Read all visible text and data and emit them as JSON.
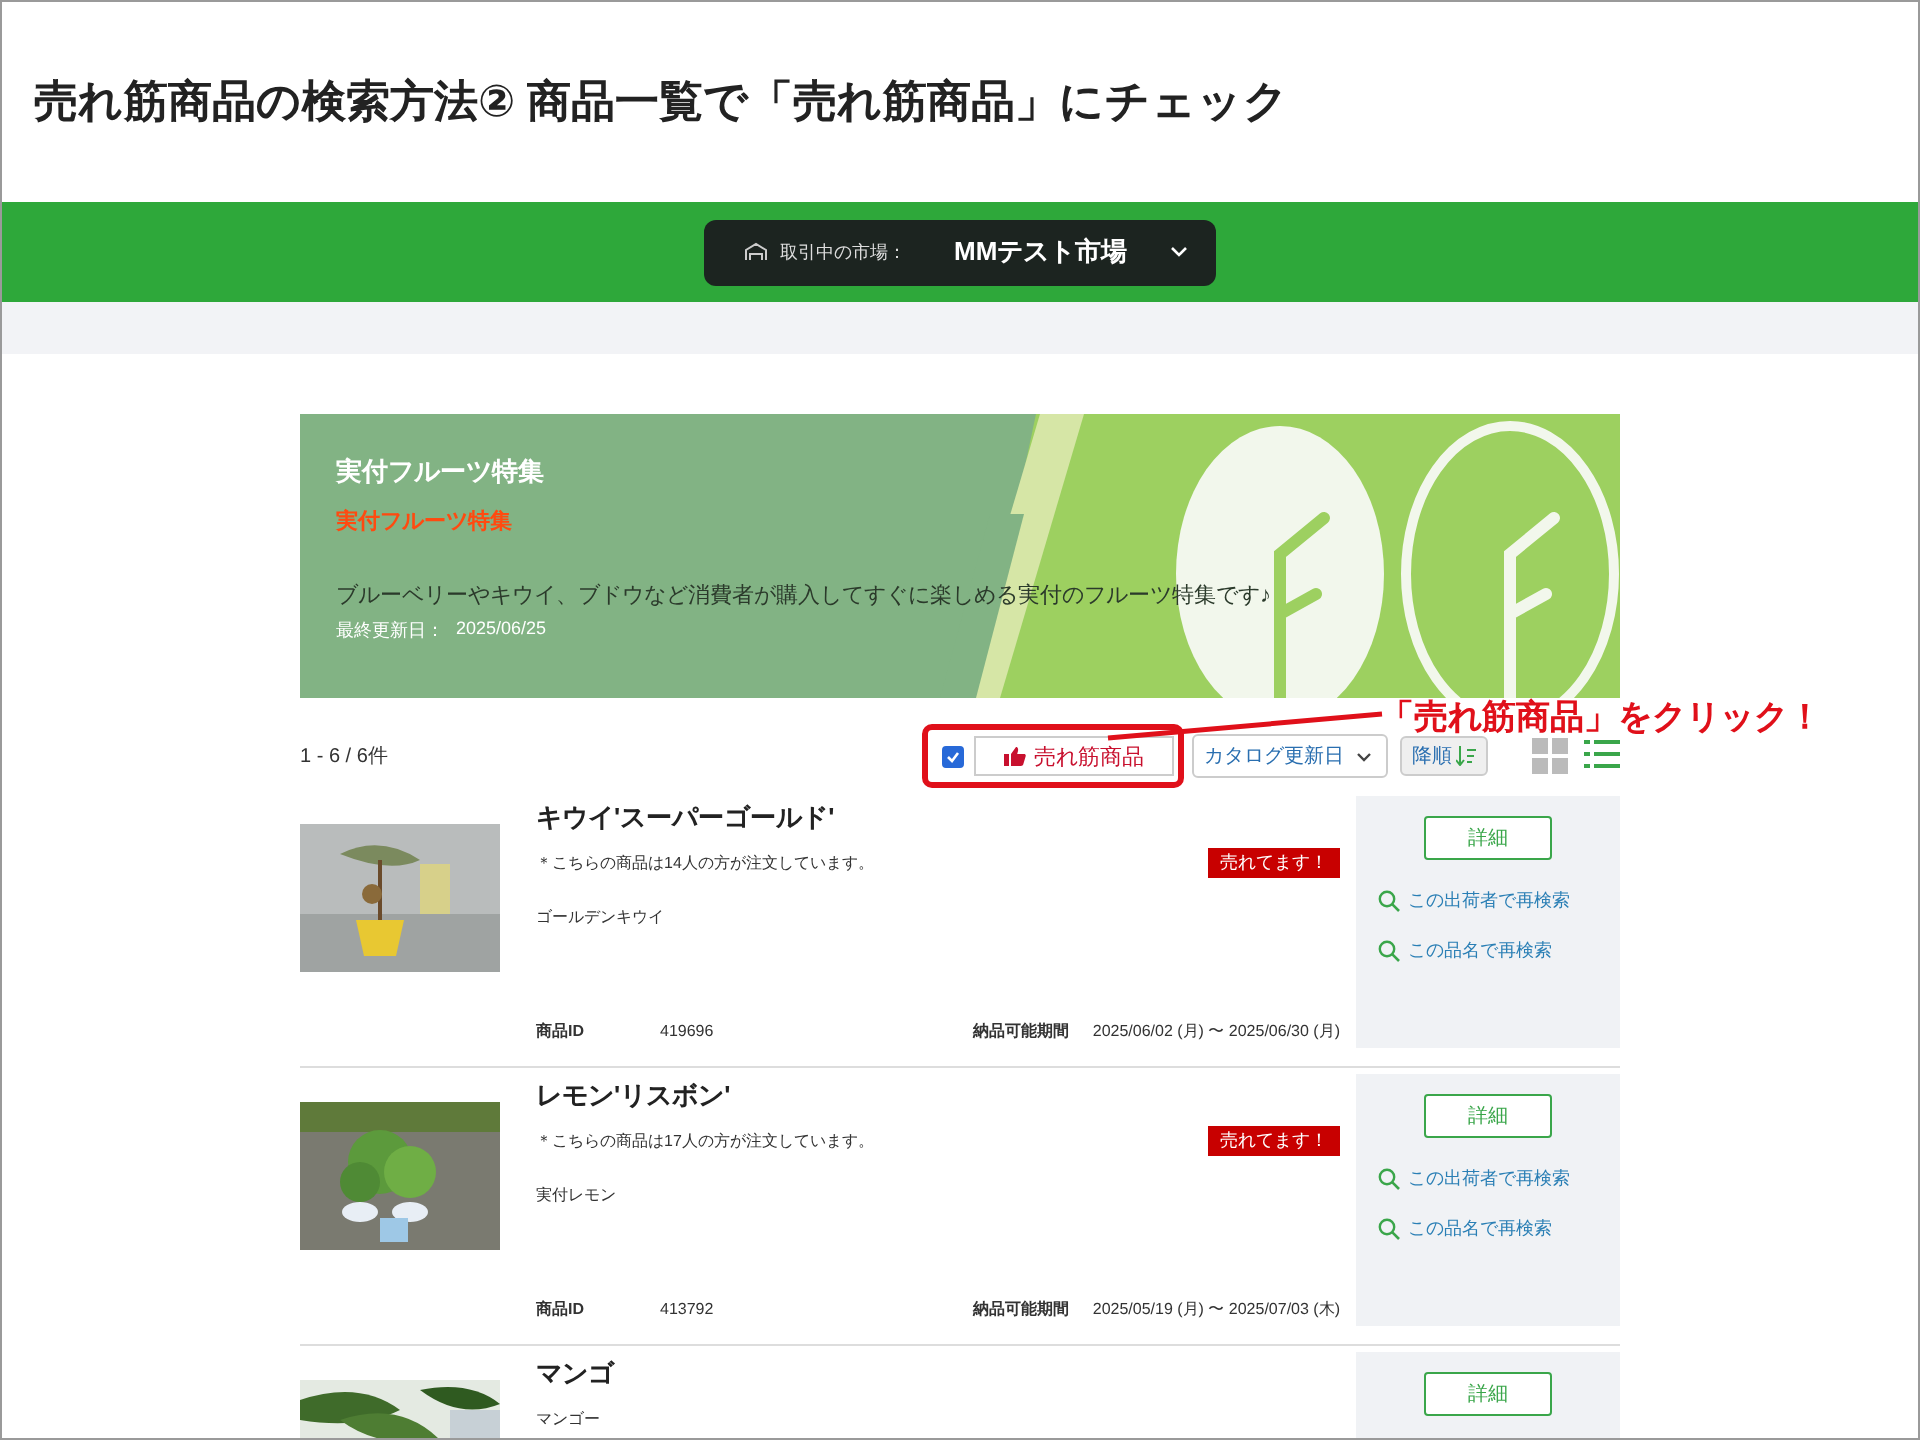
{
  "slide_title": "売れ筋商品の検索方法② 商品一覧で「売れ筋商品」にチェック",
  "market_bar": {
    "label": "取引中の市場：",
    "value": "MMテスト市場"
  },
  "banner": {
    "title": "実付フルーツ特集",
    "subtitle": "実付フルーツ特集",
    "description": "ブルーベリーやキウイ、ブドウなど消費者が購入してすぐに楽しめる実付のフルーツ特集です♪",
    "updated_label": "最終更新日：",
    "updated_date": "2025/06/25"
  },
  "toolbar": {
    "count": "1 - 6 / 6件",
    "bestseller_filter": {
      "label": "売れ筋商品",
      "checked": true
    },
    "sort": {
      "value": "カタログ更新日"
    },
    "order_button": "降順",
    "view_modes": [
      {
        "kind": "grid",
        "selected": false
      },
      {
        "kind": "list",
        "selected": true
      }
    ]
  },
  "products": [
    {
      "name": "キウイ'スーパーゴールド'",
      "note": "＊こちらの商品は14人の方が注文しています。",
      "variety": "ゴールデンキウイ",
      "badge": "売れてます！",
      "id_label": "商品ID",
      "id": "419696",
      "period_label": "納品可能期間",
      "period": "2025/06/02 (月) 〜 2025/06/30 (月)",
      "detail_button": "詳細",
      "links": [
        "この出荷者で再検索",
        "この品名で再検索"
      ]
    },
    {
      "name": "レモン'リスボン'",
      "note": "＊こちらの商品は17人の方が注文しています。",
      "variety": "実付レモン",
      "badge": "売れてます！",
      "id_label": "商品ID",
      "id": "413792",
      "period_label": "納品可能期間",
      "period": "2025/05/19 (月) 〜 2025/07/03 (木)",
      "detail_button": "詳細",
      "links": [
        "この出荷者で再検索",
        "この品名で再検索"
      ]
    },
    {
      "name": "マンゴ",
      "variety": "マンゴー",
      "detail_button": "詳細"
    }
  ],
  "callout": {
    "text": "「売れ筋商品」をクリック！"
  }
}
